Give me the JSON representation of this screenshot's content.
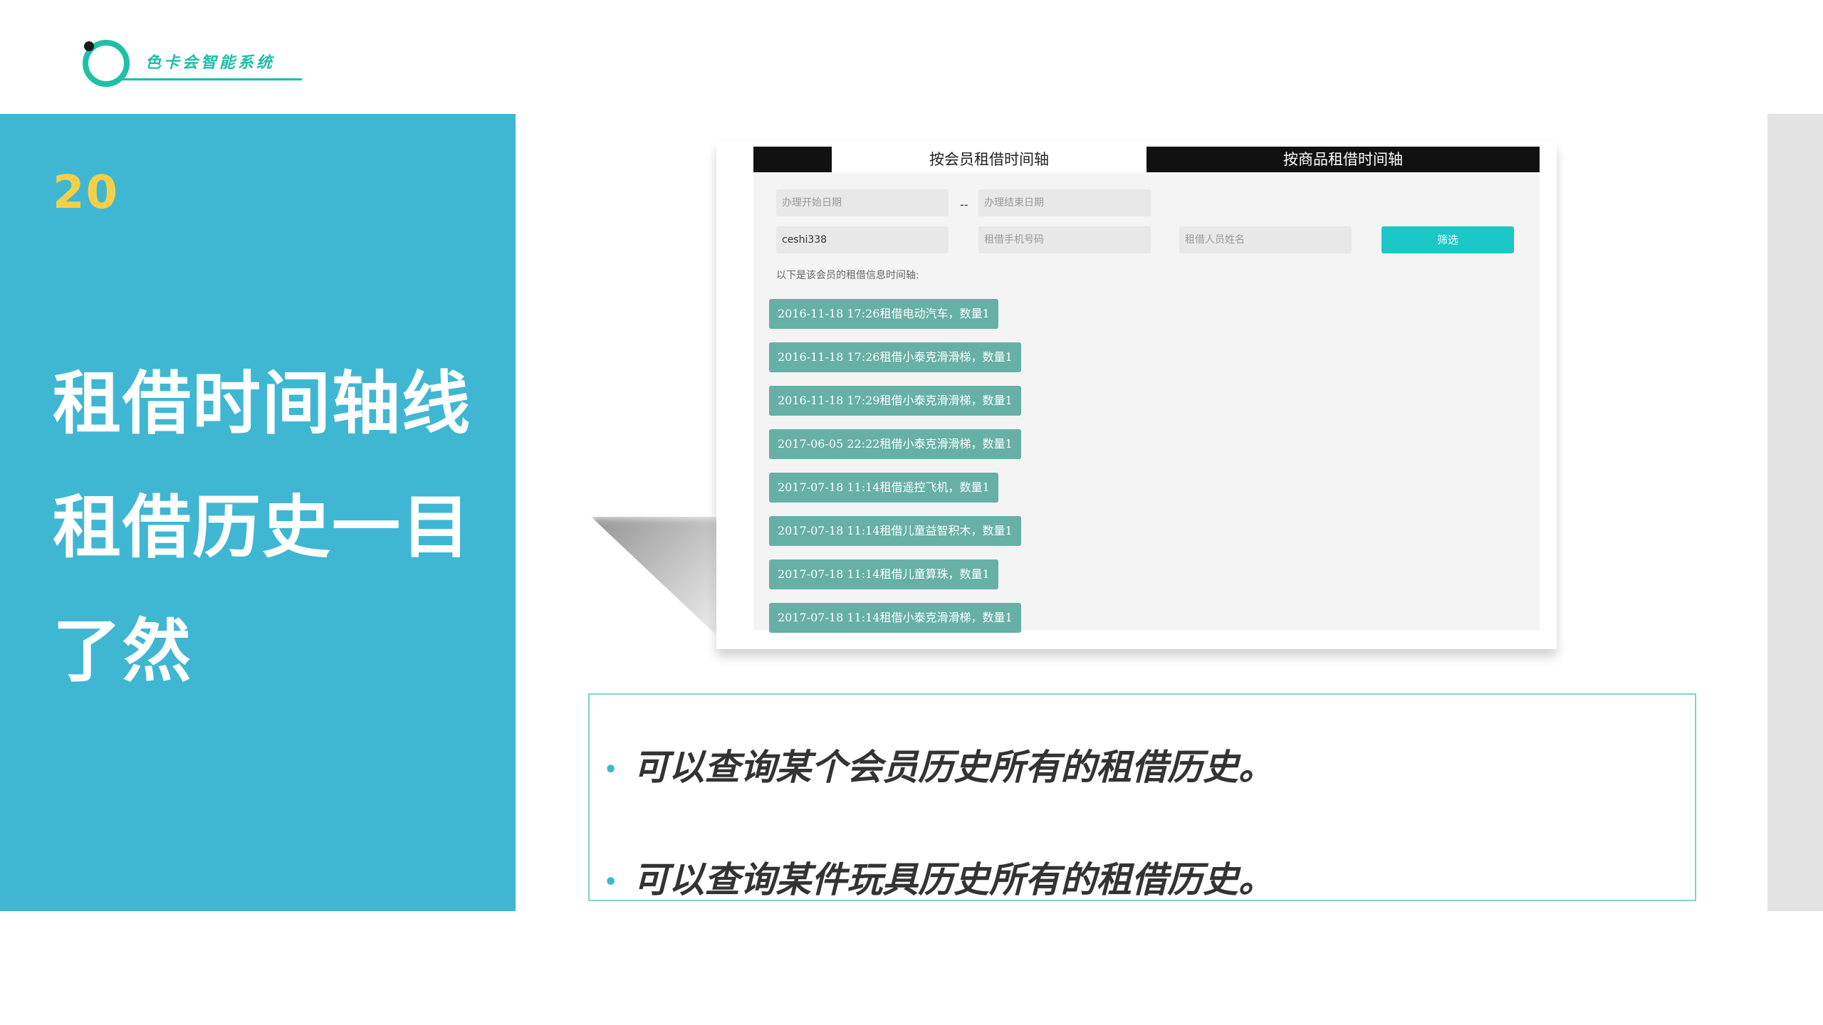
{
  "logo": {
    "text": "色卡会智能系统"
  },
  "left_panel": {
    "slide_number": "20",
    "headline_lines": [
      "租借时间轴线",
      "租借历史一目",
      "了然"
    ]
  },
  "screenshot": {
    "tabs": {
      "member": "按会员租借时间轴",
      "goods": "按商品租借时间轴"
    },
    "fields": {
      "start_date": "办理开始日期",
      "date_separator": "--",
      "end_date": "办理结束日期",
      "member_value": "ceshi338",
      "phone": "租借手机号码",
      "name": "租借人员姓名"
    },
    "filter_button": "筛选",
    "hint": "以下是该会员的租借信息时间轴:",
    "records": [
      "2016-11-18 17:26租借电动汽车，数量1",
      "2016-11-18 17:26租借小泰克滑滑梯，数量1",
      "2016-11-18 17:29租借小泰克滑滑梯，数量1",
      "2017-06-05 22:22租借小泰克滑滑梯，数量1",
      "2017-07-18 11:14租借遥控飞机，数量1",
      "2017-07-18 11:14租借儿童益智积木，数量1",
      "2017-07-18 11:14租借儿童算珠，数量1",
      "2017-07-18 11:14租借小泰克滑滑梯，数量1"
    ]
  },
  "bullets": [
    "可以查询某个会员历史所有的租借历史。",
    "可以查询某件玩具历史所有的租借历史。"
  ],
  "colors": {
    "panel_blue": "#3fb7d3",
    "number_yellow": "#f6cf4a",
    "logo_teal": "#1fbfa8",
    "record_green": "#66b0a6",
    "filter_cyan": "#1cc7c7"
  }
}
